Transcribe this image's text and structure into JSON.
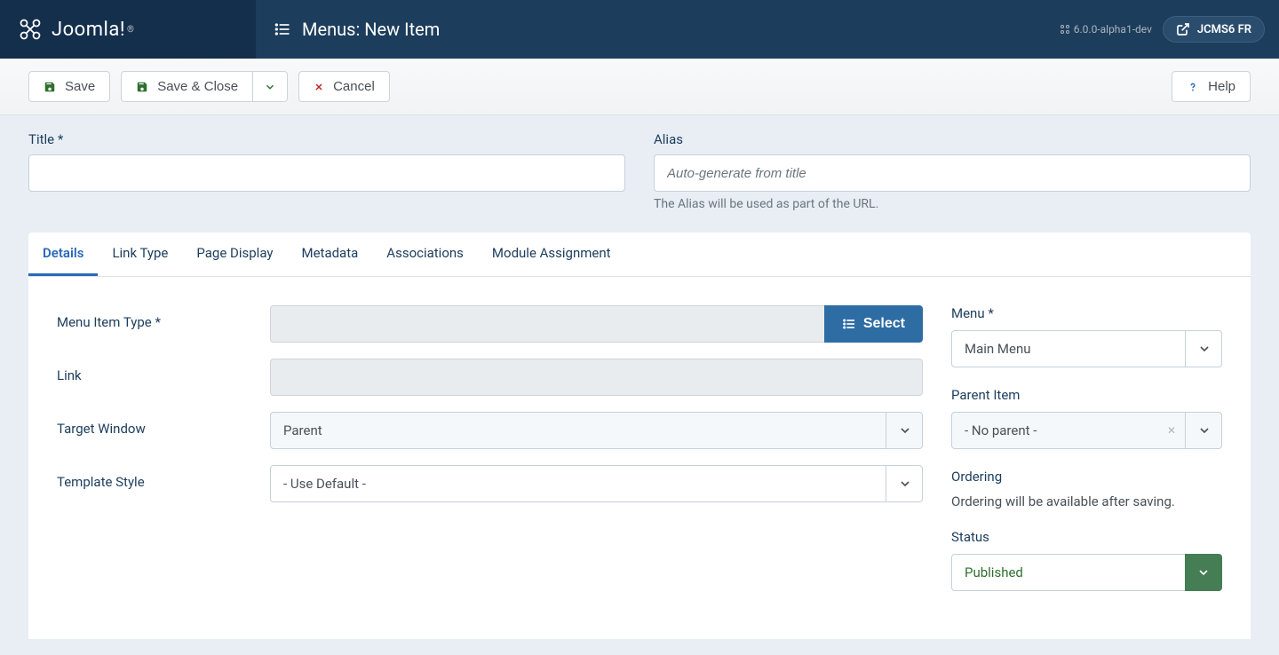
{
  "header": {
    "logo_text": "Joomla!",
    "page_title": "Menus: New Item",
    "version": "6.0.0-alpha1-dev",
    "badge": "JCMS6 FR"
  },
  "toolbar": {
    "save": "Save",
    "save_close": "Save & Close",
    "cancel": "Cancel",
    "help": "Help"
  },
  "fields": {
    "title_label": "Title *",
    "alias_label": "Alias",
    "alias_placeholder": "Auto-generate from title",
    "alias_help": "The Alias will be used as part of the URL."
  },
  "tabs": [
    {
      "label": "Details",
      "active": true
    },
    {
      "label": "Link Type",
      "active": false
    },
    {
      "label": "Page Display",
      "active": false
    },
    {
      "label": "Metadata",
      "active": false
    },
    {
      "label": "Associations",
      "active": false
    },
    {
      "label": "Module Assignment",
      "active": false
    }
  ],
  "main": {
    "menu_item_type_label": "Menu Item Type *",
    "select_label": "Select",
    "link_label": "Link",
    "target_window_label": "Target Window",
    "target_window_value": "Parent",
    "template_style_label": "Template Style",
    "template_style_value": "- Use Default -"
  },
  "side": {
    "menu_label": "Menu *",
    "menu_value": "Main Menu",
    "parent_label": "Parent Item",
    "parent_value": "- No parent -",
    "ordering_label": "Ordering",
    "ordering_text": "Ordering will be available after saving.",
    "status_label": "Status",
    "status_value": "Published"
  }
}
